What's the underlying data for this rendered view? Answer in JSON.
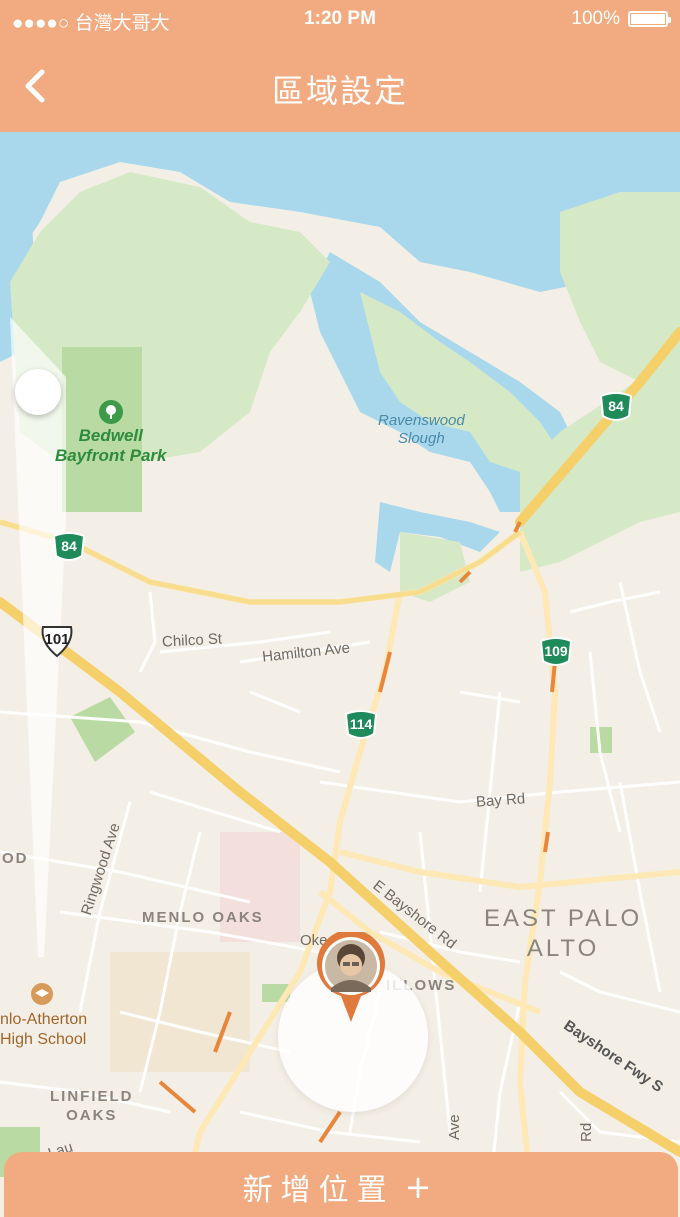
{
  "status_bar": {
    "carrier": "●●●●○ 台灣大哥大",
    "time": "1:20 PM",
    "battery": "100%"
  },
  "nav": {
    "title": "區域設定",
    "back_icon": "chevron-left-icon"
  },
  "map": {
    "park_label": "Bedwell\nBayfront Park",
    "water_label": "Ravenswood\nSlough",
    "roads": {
      "chilco": "Chilco St",
      "hamilton": "Hamilton Ave",
      "bay": "Bay Rd",
      "ringwood": "Ringwood Ave",
      "e_bayshore": "E Bayshore Rd",
      "bayshore_fwy": "Bayshore Fwy S",
      "oke": "Oke",
      "laurel": "Lau",
      "ave": "Ave",
      "rd": "Rd"
    },
    "districts": {
      "menlo_oaks": "MENLO OAKS",
      "linfield_oaks": "LINFIELD\nOAKS",
      "willows": "ILLOWS",
      "od": "OD"
    },
    "city": "EAST PALO\nALTO",
    "school": "nlo-Atherton\nHigh School",
    "shields": {
      "hwy84_top": "84",
      "hwy84_left": "84",
      "hwy101": "101",
      "hwy109": "109",
      "hwy114": "114"
    }
  },
  "add_button": {
    "label": "新增位置",
    "icon": "+"
  },
  "colors": {
    "accent": "#f2ab81",
    "water": "#a9d8ec",
    "park": "#d6e9c6",
    "land": "#f4efe6",
    "highway": "#f5d06a"
  }
}
